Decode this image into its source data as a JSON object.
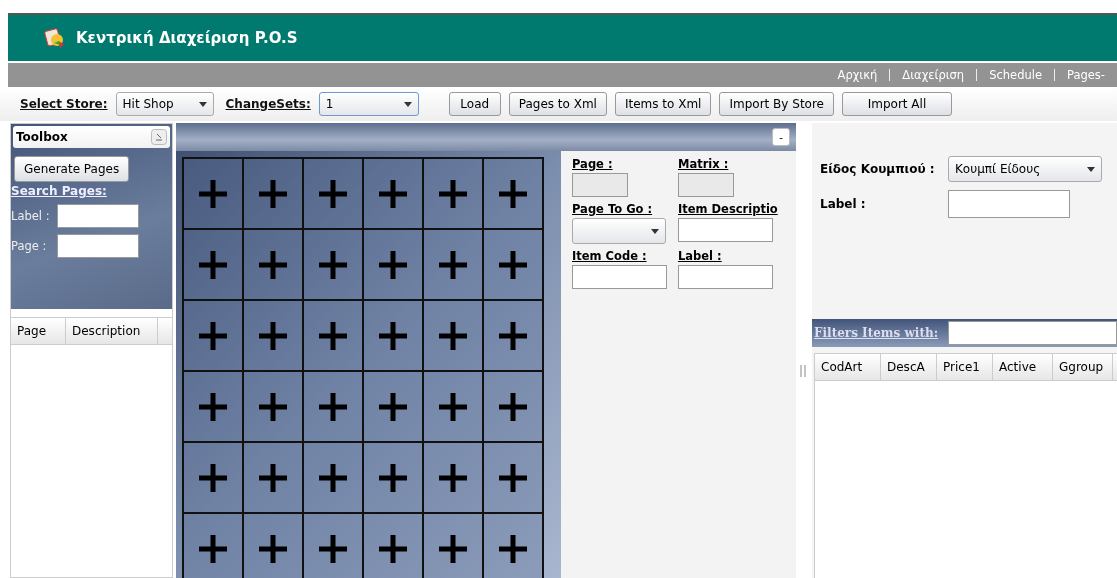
{
  "app": {
    "title": "Κεντρική Διαχείριση P.O.S"
  },
  "nav": [
    {
      "label": "Αρχική"
    },
    {
      "label": "Διαχείριση"
    },
    {
      "label": "Schedule"
    },
    {
      "label": "Pages-"
    }
  ],
  "toolbar": {
    "store_label": "Select Store:",
    "store_value": "Hit Shop",
    "changesets_label": "ChangeSets:",
    "changesets_value": "1",
    "buttons": [
      "Load",
      "Pages to Xml",
      "Items to Xml",
      "Import By Store",
      "Import All"
    ]
  },
  "toolbox": {
    "title": "Toolbox",
    "generate_button": "Generate Pages",
    "search_heading": "Search Pages:",
    "fields": [
      {
        "label": "Label :"
      },
      {
        "label": "Page :"
      }
    ],
    "columns": [
      "Page",
      "Description"
    ]
  },
  "page_grid": {
    "collapse_button": "-",
    "rows": [
      {
        "cells": [
          {
            "kind": "add"
          },
          {
            "kind": "add"
          },
          {
            "kind": "add"
          },
          {
            "kind": "add"
          },
          {
            "kind": "add"
          },
          {
            "kind": "add"
          }
        ]
      },
      {
        "cells": [
          {
            "kind": "add"
          },
          {
            "kind": "add"
          },
          {
            "kind": "add"
          },
          {
            "kind": "add"
          },
          {
            "kind": "add"
          },
          {
            "kind": "add"
          }
        ]
      },
      {
        "cells": [
          {
            "kind": "add"
          },
          {
            "kind": "add"
          },
          {
            "kind": "add"
          },
          {
            "kind": "add"
          },
          {
            "kind": "add"
          },
          {
            "kind": "add"
          }
        ]
      },
      {
        "cells": [
          {
            "kind": "add"
          },
          {
            "kind": "add"
          },
          {
            "kind": "add"
          },
          {
            "kind": "add"
          },
          {
            "kind": "add"
          },
          {
            "kind": "add"
          }
        ]
      },
      {
        "cells": [
          {
            "kind": "add"
          },
          {
            "kind": "add"
          },
          {
            "kind": "add"
          },
          {
            "kind": "add"
          },
          {
            "kind": "add"
          },
          {
            "kind": "add"
          }
        ]
      },
      {
        "cells": [
          {
            "kind": "add"
          },
          {
            "kind": "add"
          },
          {
            "kind": "add"
          },
          {
            "kind": "add"
          },
          {
            "kind": "add"
          },
          {
            "kind": "add"
          }
        ]
      }
    ]
  },
  "editor": {
    "fields": [
      {
        "label": "Page :",
        "kind": "readonly"
      },
      {
        "label": "Matrix :",
        "kind": "readonly"
      },
      {
        "label": "Page To Go :",
        "kind": "dropdown"
      },
      {
        "label": "Item Descriptio",
        "kind": "text"
      },
      {
        "label": "Item Code :",
        "kind": "text"
      },
      {
        "label": "Label :",
        "kind": "text"
      }
    ]
  },
  "button_settings": {
    "fields": [
      {
        "label": "Είδος Κουμπιού :",
        "kind": "dropdown",
        "value": "Κουμπί Είδους"
      },
      {
        "label": "Label :",
        "kind": "text"
      }
    ]
  },
  "items": {
    "filter_label": "Filters Items with:",
    "columns": [
      "CodArt",
      "DescA",
      "Price1",
      "Active",
      "Ggroup"
    ]
  }
}
